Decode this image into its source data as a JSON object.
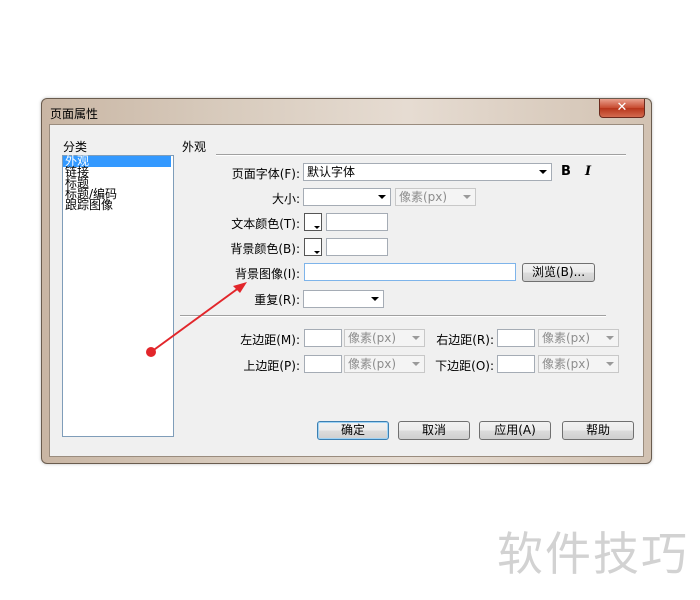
{
  "window": {
    "title": "页面属性",
    "close_glyph": "✕"
  },
  "categories": {
    "label": "分类",
    "items": [
      "外观",
      "链接",
      "标题",
      "标题/编码",
      "跟踪图像"
    ],
    "selected_index": 0
  },
  "section": {
    "label": "外观"
  },
  "form": {
    "page_font_label": "页面字体(F):",
    "page_font_value": "默认字体",
    "bold_glyph": "B",
    "italic_glyph": "I",
    "size_label": "大小:",
    "size_value": "",
    "size_unit": "像素(px)",
    "text_color_label": "文本颜色(T):",
    "text_color_value": "",
    "bg_color_label": "背景颜色(B):",
    "bg_color_value": "",
    "bg_image_label": "背景图像(I):",
    "bg_image_value": "",
    "browse_button": "浏览(B)...",
    "repeat_label": "重复(R):",
    "repeat_value": ""
  },
  "margins": {
    "left_label": "左边距(M):",
    "right_label": "右边距(R):",
    "top_label": "上边距(P):",
    "bottom_label": "下边距(O):",
    "unit": "像素(px)"
  },
  "buttons": {
    "ok": "确定",
    "cancel": "取消",
    "apply": "应用(A)",
    "help": "帮助"
  },
  "annotation": {
    "color": "#e2262b"
  },
  "watermark": "软件技巧"
}
